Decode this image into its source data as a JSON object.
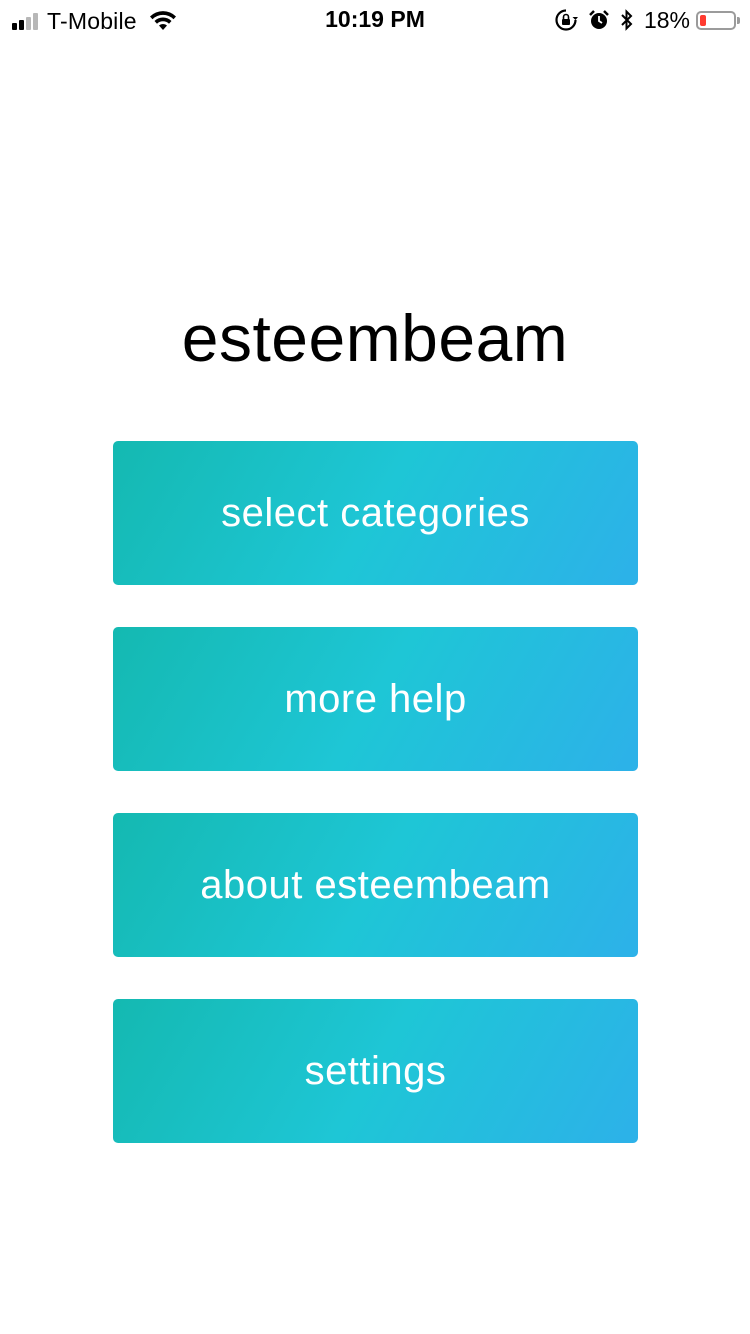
{
  "status_bar": {
    "carrier": "T-Mobile",
    "time": "10:19 PM",
    "battery_percent": "18%",
    "battery_level": 0.18,
    "signal_bars_filled": 2,
    "signal_bars_total": 4,
    "icons": [
      "wifi-icon",
      "orientation-lock-icon",
      "alarm-icon",
      "bluetooth-icon",
      "battery-icon"
    ],
    "battery_color": "#ff3b30"
  },
  "app": {
    "title": "esteembeam"
  },
  "menu": {
    "buttons": [
      {
        "label": "select categories"
      },
      {
        "label": "more help"
      },
      {
        "label": "about esteembeam"
      },
      {
        "label": "settings"
      }
    ],
    "gradient_colors": [
      "#14b9b1",
      "#1ec6d6",
      "#2db1e9"
    ]
  }
}
